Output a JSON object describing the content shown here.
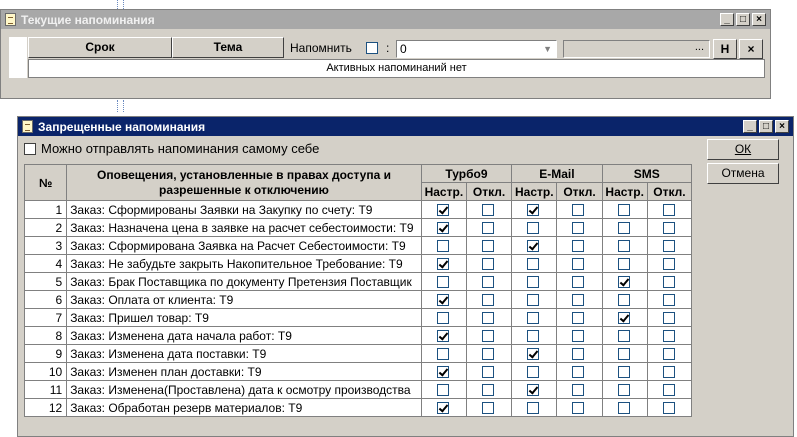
{
  "reminders_window": {
    "title": "Текущие напоминания",
    "col_due": "Срок",
    "col_subject": "Тема",
    "remind_label": "Напомнить",
    "colon": ":",
    "remind_value": "0",
    "ellipsis": "...",
    "btn_h": "Н",
    "btn_x": "×",
    "empty_text": "Активных напоминаний нет"
  },
  "forbidden_window": {
    "title": "Запрещенные напоминания",
    "self_send_label": "Можно отправлять напоминания самому себе",
    "self_send_checked": false,
    "ok_label": "ОК",
    "cancel_label": "Отмена",
    "table": {
      "col_num": "№",
      "col_name": "Оповещения, установленные в правах доступа и разрешенные к отключению",
      "groups": [
        "Турбо9",
        "E-Mail",
        "SMS"
      ],
      "sub_setting": "Настр.",
      "sub_off": "Откл.",
      "rows": [
        {
          "num": "1",
          "name": "Заказ: Сформированы Заявки на Закупку по счету: Т9",
          "checks": [
            true,
            false,
            true,
            false,
            false,
            false
          ]
        },
        {
          "num": "2",
          "name": "Заказ: Назначена цена в заявке на расчет себестоимости: Т9",
          "checks": [
            true,
            false,
            false,
            false,
            false,
            false
          ]
        },
        {
          "num": "3",
          "name": "Заказ: Сформирована Заявка на Расчет Себестоимости: Т9",
          "checks": [
            false,
            false,
            true,
            false,
            false,
            false
          ]
        },
        {
          "num": "4",
          "name": "Заказ: Не забудьте закрыть Накопительное Требование: Т9",
          "checks": [
            true,
            false,
            false,
            false,
            false,
            false
          ]
        },
        {
          "num": "5",
          "name": "Заказ: Брак Поставщика по документу Претензия Поставщик",
          "checks": [
            false,
            false,
            false,
            false,
            true,
            false
          ]
        },
        {
          "num": "6",
          "name": "Заказ: Оплата от клиента: Т9",
          "checks": [
            true,
            false,
            false,
            false,
            false,
            false
          ]
        },
        {
          "num": "7",
          "name": "Заказ: Пришел товар: Т9",
          "checks": [
            false,
            false,
            false,
            false,
            true,
            false
          ]
        },
        {
          "num": "8",
          "name": "Заказ: Изменена дата начала работ: Т9",
          "checks": [
            true,
            false,
            false,
            false,
            false,
            false
          ]
        },
        {
          "num": "9",
          "name": "Заказ: Изменена дата поставки: Т9",
          "checks": [
            false,
            false,
            true,
            false,
            false,
            false
          ]
        },
        {
          "num": "10",
          "name": "Заказ: Изменен план доставки: Т9",
          "checks": [
            true,
            false,
            false,
            false,
            false,
            false
          ]
        },
        {
          "num": "11",
          "name": "Заказ: Изменена(Проставлена) дата к осмотру производства",
          "checks": [
            false,
            false,
            true,
            false,
            false,
            false
          ]
        },
        {
          "num": "12",
          "name": "Заказ: Обработан резерв материалов: Т9",
          "checks": [
            true,
            false,
            false,
            false,
            false,
            false
          ]
        }
      ]
    }
  }
}
